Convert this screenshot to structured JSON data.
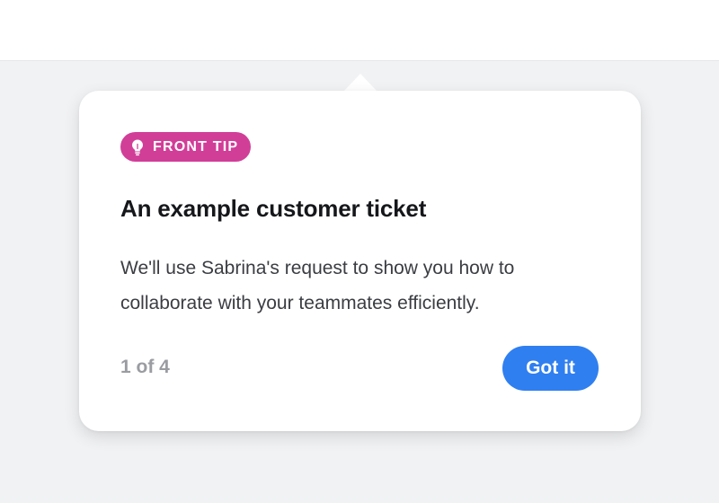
{
  "colors": {
    "background": "#f1f2f4",
    "card": "#ffffff",
    "badge": "#d13e98",
    "primary_button": "#2f7ff0",
    "title": "#16171a",
    "body_text": "#3b3d42",
    "muted_text": "#9a9ca1"
  },
  "tooltip": {
    "badge": {
      "icon": "lightbulb-icon",
      "label": "FRONT TIP"
    },
    "title": "An example customer ticket",
    "body": "We'll use Sabrina's request to show you how to collaborate with your teammates efficiently.",
    "step_counter": "1 of 4",
    "primary_button_label": "Got it"
  }
}
